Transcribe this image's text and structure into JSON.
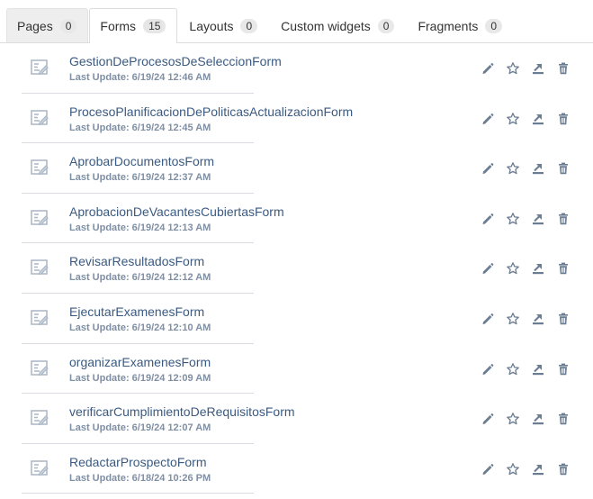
{
  "tabs": [
    {
      "label": "Pages",
      "count": "0"
    },
    {
      "label": "Forms",
      "count": "15"
    },
    {
      "label": "Layouts",
      "count": "0"
    },
    {
      "label": "Custom widgets",
      "count": "0"
    },
    {
      "label": "Fragments",
      "count": "0"
    }
  ],
  "items": [
    {
      "name": "GestionDeProcesosDeSeleccionForm",
      "updated": "Last Update: 6/19/24 12:46 AM"
    },
    {
      "name": "ProcesoPlanificacionDePoliticasActualizacionForm",
      "updated": "Last Update: 6/19/24 12:45 AM"
    },
    {
      "name": "AprobarDocumentosForm",
      "updated": "Last Update: 6/19/24 12:37 AM"
    },
    {
      "name": "AprobacionDeVacantesCubiertasForm",
      "updated": "Last Update: 6/19/24 12:13 AM"
    },
    {
      "name": "RevisarResultadosForm",
      "updated": "Last Update: 6/19/24 12:12 AM"
    },
    {
      "name": "EjecutarExamenesForm",
      "updated": "Last Update: 6/19/24 12:10 AM"
    },
    {
      "name": "organizarExamenesForm",
      "updated": "Last Update: 6/19/24 12:09 AM"
    },
    {
      "name": "verificarCumplimientoDeRequisitosForm",
      "updated": "Last Update: 6/19/24 12:07 AM"
    },
    {
      "name": "RedactarProspectoForm",
      "updated": "Last Update: 6/18/24 10:26 PM"
    }
  ],
  "icons": {
    "form": "form-icon",
    "edit": "pencil-icon",
    "favorite": "star-icon",
    "export": "export-icon",
    "delete": "trash-icon"
  },
  "colors": {
    "title": "#3a5a82",
    "subtitle": "#7f8fa4",
    "icon": "#6b7d92"
  }
}
